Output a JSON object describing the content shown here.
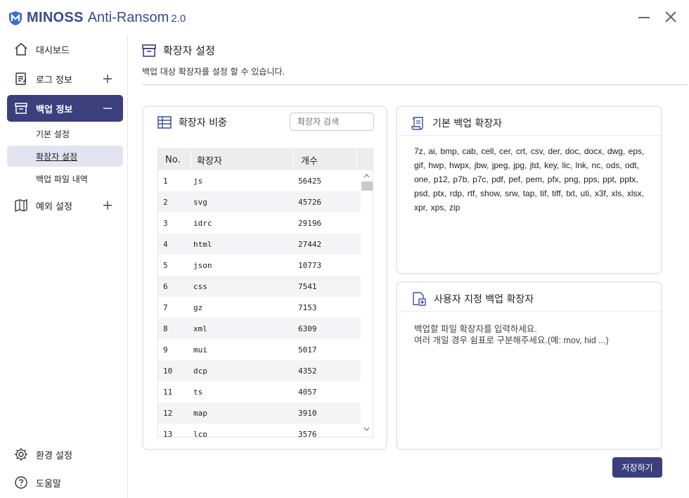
{
  "app": {
    "brand": "MINOSS",
    "product": "Anti-Ransom",
    "version": "2.0",
    "colors": {
      "brand": "#3a4a8c",
      "active_nav": "#3b3f7c",
      "active_sub": "#e2e4ef"
    }
  },
  "window_controls": {
    "minimize_icon": "minimize-icon",
    "close_icon": "close-icon"
  },
  "sidebar": {
    "dashboard": "대시보드",
    "log": "로그 정보",
    "backup": "백업 정보",
    "backup_sub": {
      "basic": "기본 설정",
      "extension": "확장자 설정",
      "history": "백업 파일 내역"
    },
    "exception": "예외 설정",
    "settings": "환경 설정",
    "help": "도움말"
  },
  "page": {
    "title": "확장자 설정",
    "description": "백업 대상 확장자를 설정 할 수 있습니다."
  },
  "ratio_panel": {
    "title": "확장자 비중",
    "search_placeholder": "확장자 검색",
    "columns": [
      "No.",
      "확장자",
      "개수"
    ],
    "rows": [
      {
        "no": "1",
        "ext": "js",
        "count": "56425"
      },
      {
        "no": "2",
        "ext": "svg",
        "count": "45726"
      },
      {
        "no": "3",
        "ext": "idrc",
        "count": "29196"
      },
      {
        "no": "4",
        "ext": "html",
        "count": "27442"
      },
      {
        "no": "5",
        "ext": "json",
        "count": "10773"
      },
      {
        "no": "6",
        "ext": "css",
        "count": "7541"
      },
      {
        "no": "7",
        "ext": "gz",
        "count": "7153"
      },
      {
        "no": "8",
        "ext": "xml",
        "count": "6309"
      },
      {
        "no": "9",
        "ext": "mui",
        "count": "5017"
      },
      {
        "no": "10",
        "ext": "dcp",
        "count": "4352"
      },
      {
        "no": "11",
        "ext": "ts",
        "count": "4057"
      },
      {
        "no": "12",
        "ext": "map",
        "count": "3910"
      },
      {
        "no": "13",
        "ext": "lcp",
        "count": "3576"
      }
    ]
  },
  "default_panel": {
    "title": "기본 백업 확장자",
    "extensions": "7z, ai, bmp, cab, cell, cer, crt, csv, der, doc, docx, dwg, eps, gif, hwp, hwpx, jbw, jpeg, jpg, jtd, key, lic, lnk, nc, ods, odt, one, p12, p7b, p7c, pdf, pef, pem, pfx, png, pps, ppt, pptx, psd, ptx, rdp, rtf, show, srw, tap, tif, tiff, txt, uti, x3f, xls, xlsx, xpr, xps, zip"
  },
  "custom_panel": {
    "title": "사용자 지정 백업 확장자",
    "value": "",
    "placeholder": "백업할 파일 확장자를 입력하세요.\n여러 개일 경우 쉼표로 구분해주세요.(예: mov, hid ...)"
  },
  "save_label": "저장하기"
}
